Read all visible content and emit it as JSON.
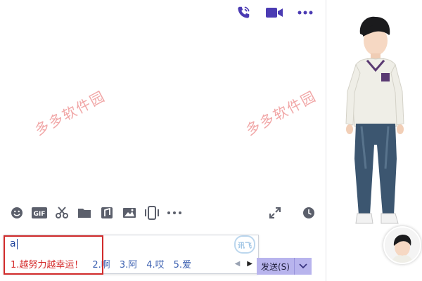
{
  "watermarks": [
    "多多软件园",
    "多多软件园"
  ],
  "ime": {
    "input_text": "a",
    "logo": "讯飞",
    "candidates": [
      "1.越努力越幸运！",
      "2.啊",
      "3.阿",
      "4.哎",
      "5.爱"
    ]
  },
  "send": {
    "label": "发送(S)"
  },
  "icons": {
    "top": [
      "phone-icon",
      "video-icon",
      "more-icon"
    ],
    "toolbar": [
      "emoji-icon",
      "gif-icon",
      "scissors-icon",
      "folder-icon",
      "music-icon",
      "image-icon",
      "shake-icon",
      "more-icon"
    ],
    "toolbar_right": [
      "expand-icon",
      "history-clock-icon"
    ]
  },
  "colors": {
    "accent": "#4b3bb3",
    "highlight": "#d12b2b",
    "send_bg": "#b8b4ed"
  }
}
